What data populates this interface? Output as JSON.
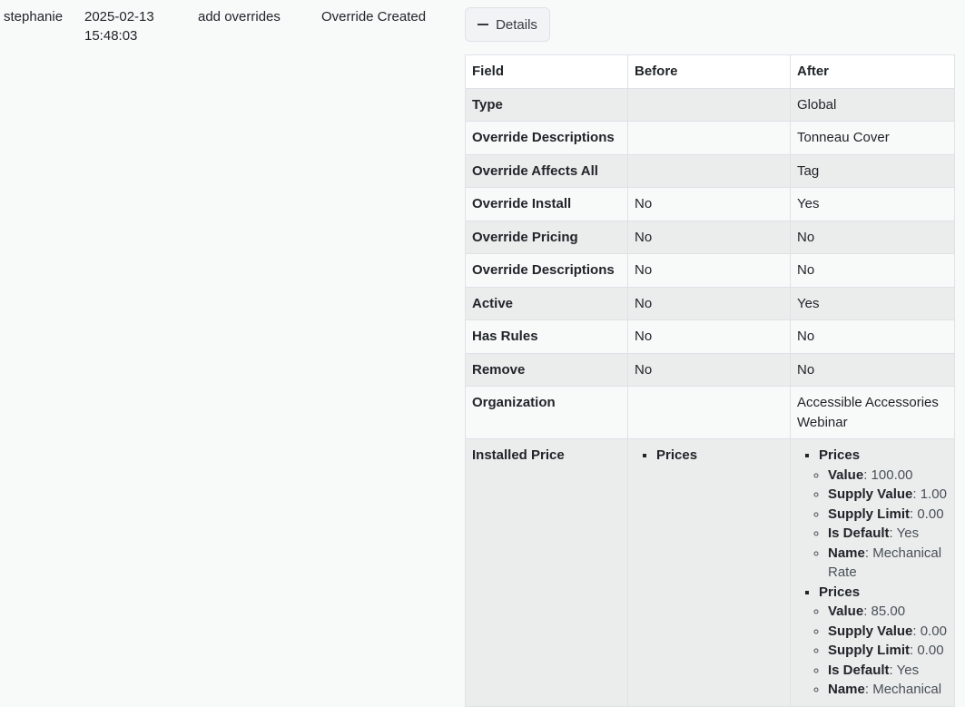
{
  "entry": {
    "user": "stephanie",
    "date": "2025-02-13",
    "time": "15:48:03",
    "action": "add overrides",
    "status": "Override Created",
    "details_label": "Details"
  },
  "table": {
    "headers": [
      "Field",
      "Before",
      "After"
    ],
    "rows": [
      {
        "field": "Type",
        "before": "",
        "after": "Global"
      },
      {
        "field": "Override Descriptions",
        "before": "",
        "after": "Tonneau Cover"
      },
      {
        "field": "Override Affects All",
        "before": "",
        "after": "Tag"
      },
      {
        "field": "Override Install",
        "before": "No",
        "after": "Yes"
      },
      {
        "field": "Override Pricing",
        "before": "No",
        "after": "No"
      },
      {
        "field": "Override Descriptions",
        "before": "No",
        "after": "No"
      },
      {
        "field": "Active",
        "before": "No",
        "after": "Yes"
      },
      {
        "field": "Has Rules",
        "before": "No",
        "after": "No"
      },
      {
        "field": "Remove",
        "before": "No",
        "after": "No"
      },
      {
        "field": "Organization",
        "before": "",
        "after": "Accessible Accessories Webinar"
      }
    ],
    "installed_price": {
      "field": "Installed Price",
      "before_title": "Prices",
      "after_groups": [
        {
          "title": "Prices",
          "items": [
            {
              "key": "Value",
              "value": "100.00"
            },
            {
              "key": "Supply Value",
              "value": "1.00"
            },
            {
              "key": "Supply Limit",
              "value": "0.00"
            },
            {
              "key": "Is Default",
              "value": "Yes"
            },
            {
              "key": "Name",
              "value": "Mechanical Rate"
            }
          ]
        },
        {
          "title": "Prices",
          "items": [
            {
              "key": "Value",
              "value": "85.00"
            },
            {
              "key": "Supply Value",
              "value": "0.00"
            },
            {
              "key": "Supply Limit",
              "value": "0.00"
            },
            {
              "key": "Is Default",
              "value": "Yes"
            },
            {
              "key": "Name",
              "value": "Mechanical"
            }
          ]
        }
      ]
    }
  }
}
